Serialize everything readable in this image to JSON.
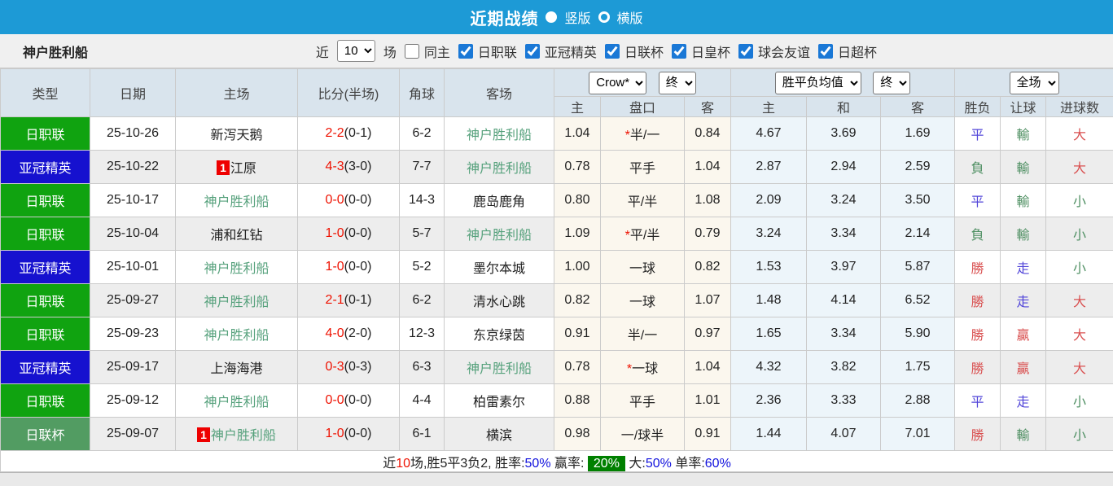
{
  "header": {
    "title": "近期战绩",
    "vertical_label": "竖版",
    "horizontal_label": "横版"
  },
  "filter": {
    "team": "神户胜利船",
    "near_label": "近",
    "count_value": "10",
    "games_label": "场",
    "same_home_label": "同主",
    "leagues": [
      "日职联",
      "亚冠精英",
      "日联杯",
      "日皇杯",
      "球会友谊",
      "日超杯"
    ]
  },
  "table": {
    "selects": {
      "company": "Crow*",
      "company_state": "终",
      "avg": "胜平负均值",
      "avg_state": "终",
      "scope": "全场"
    },
    "columns": {
      "type": "类型",
      "date": "日期",
      "home": "主场",
      "score": "比分(半场)",
      "corner": "角球",
      "away": "客场"
    },
    "sub_columns": [
      "主",
      "盘口",
      "客",
      "主",
      "和",
      "客",
      "胜负",
      "让球",
      "进球数"
    ],
    "rows": [
      {
        "type": "日职联",
        "date": "25-10-26",
        "home": "新泻天鹅",
        "score": "2-2",
        "half": "(0-1)",
        "corner": "6-2",
        "away": "神户胜利船",
        "odds_home": "1.04",
        "hstar": "*",
        "handicap": "半/一",
        "odds_away": "0.84",
        "avg_home": "4.67",
        "avg_draw": "3.69",
        "avg_away": "1.69",
        "result": "平",
        "handicap_result": "輸",
        "goals": "大"
      },
      {
        "type": "亚冠精英",
        "date": "25-10-22",
        "home_badge": "1",
        "home": "江原",
        "score": "4-3",
        "half": "(3-0)",
        "corner": "7-7",
        "away": "神户胜利船",
        "odds_home": "0.78",
        "hstar": "",
        "handicap": "平手",
        "odds_away": "1.04",
        "avg_home": "2.87",
        "avg_draw": "2.94",
        "avg_away": "2.59",
        "result": "負",
        "handicap_result": "輸",
        "goals": "大"
      },
      {
        "type": "日职联",
        "date": "25-10-17",
        "home": "神户胜利船",
        "score": "0-0",
        "half": "(0-0)",
        "corner": "14-3",
        "away": "鹿岛鹿角",
        "odds_home": "0.80",
        "hstar": "",
        "handicap": "平/半",
        "odds_away": "1.08",
        "avg_home": "2.09",
        "avg_draw": "3.24",
        "avg_away": "3.50",
        "result": "平",
        "handicap_result": "輸",
        "goals": "小"
      },
      {
        "type": "日职联",
        "date": "25-10-04",
        "home": "浦和红钻",
        "score": "1-0",
        "half": "(0-0)",
        "corner": "5-7",
        "away": "神户胜利船",
        "odds_home": "1.09",
        "hstar": "*",
        "handicap": "平/半",
        "odds_away": "0.79",
        "avg_home": "3.24",
        "avg_draw": "3.34",
        "avg_away": "2.14",
        "result": "負",
        "handicap_result": "輸",
        "goals": "小"
      },
      {
        "type": "亚冠精英",
        "date": "25-10-01",
        "home": "神户胜利船",
        "score": "1-0",
        "half": "(0-0)",
        "corner": "5-2",
        "away": "墨尔本城",
        "odds_home": "1.00",
        "hstar": "",
        "handicap": "一球",
        "odds_away": "0.82",
        "avg_home": "1.53",
        "avg_draw": "3.97",
        "avg_away": "5.87",
        "result": "勝",
        "handicap_result": "走",
        "goals": "小"
      },
      {
        "type": "日职联",
        "date": "25-09-27",
        "home": "神户胜利船",
        "score": "2-1",
        "half": "(0-1)",
        "corner": "6-2",
        "away": "清水心跳",
        "odds_home": "0.82",
        "hstar": "",
        "handicap": "一球",
        "odds_away": "1.07",
        "avg_home": "1.48",
        "avg_draw": "4.14",
        "avg_away": "6.52",
        "result": "勝",
        "handicap_result": "走",
        "goals": "大"
      },
      {
        "type": "日职联",
        "date": "25-09-23",
        "home": "神户胜利船",
        "score": "4-0",
        "half": "(2-0)",
        "corner": "12-3",
        "away": "东京绿茵",
        "odds_home": "0.91",
        "hstar": "",
        "handicap": "半/一",
        "odds_away": "0.97",
        "avg_home": "1.65",
        "avg_draw": "3.34",
        "avg_away": "5.90",
        "result": "勝",
        "handicap_result": "贏",
        "goals": "大"
      },
      {
        "type": "亚冠精英",
        "date": "25-09-17",
        "home": "上海海港",
        "score": "0-3",
        "half": "(0-3)",
        "corner": "6-3",
        "away": "神户胜利船",
        "odds_home": "0.78",
        "hstar": "*",
        "handicap": "一球",
        "odds_away": "1.04",
        "avg_home": "4.32",
        "avg_draw": "3.82",
        "avg_away": "1.75",
        "result": "勝",
        "handicap_result": "贏",
        "goals": "大"
      },
      {
        "type": "日职联",
        "date": "25-09-12",
        "home": "神户胜利船",
        "score": "0-0",
        "half": "(0-0)",
        "corner": "4-4",
        "away": "柏雷素尔",
        "odds_home": "0.88",
        "hstar": "",
        "handicap": "平手",
        "odds_away": "1.01",
        "avg_home": "2.36",
        "avg_draw": "3.33",
        "avg_away": "2.88",
        "result": "平",
        "handicap_result": "走",
        "goals": "小"
      },
      {
        "type": "日联杯",
        "date": "25-09-07",
        "home_badge": "1",
        "home": "神户胜利船",
        "score": "1-0",
        "half": "(0-0)",
        "corner": "6-1",
        "away": "横滨",
        "odds_home": "0.98",
        "hstar": "",
        "handicap": "一/球半",
        "odds_away": "0.91",
        "avg_home": "1.44",
        "avg_draw": "4.07",
        "avg_away": "7.01",
        "result": "勝",
        "handicap_result": "輸",
        "goals": "小"
      }
    ]
  },
  "summary": {
    "prefix": "近",
    "count": "10",
    "mid": "场,胜5平3负2, 胜率:",
    "win_rate": "50%",
    "profit_label": " 赢率:",
    "profit_rate": "20%",
    "big_label": " 大:",
    "big_rate": "50%",
    "single_label": " 单率:",
    "single_rate": "60%"
  }
}
